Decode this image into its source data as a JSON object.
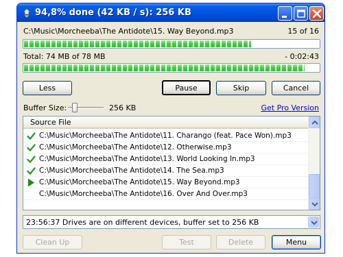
{
  "window": {
    "title": "94,8% done (42 KB / s): 256 KB"
  },
  "progress": {
    "current_file": "C:\\Music\\Morcheeba\\The Antidote\\15. Way Beyond.mp3",
    "file_count": "15 of 16",
    "file_progress_fraction": 0.77,
    "total_text": "Total: 74 MB of 78 MB",
    "remaining": "- 0:02:43",
    "total_progress_fraction": 0.95
  },
  "buttons": {
    "less": "Less",
    "pause": "Pause",
    "skip": "Skip",
    "cancel": "Cancel"
  },
  "buffer": {
    "label": "Buffer Size:",
    "value": "256 KB",
    "slider_level": 0.2,
    "pro_link": "Get Pro Version"
  },
  "list": {
    "header": "Source File",
    "rows": [
      {
        "status": "done",
        "text": "C:\\Music\\Morcheeba\\The Antidote\\11. Charango (feat. Pace Won).mp3"
      },
      {
        "status": "done",
        "text": "C:\\Music\\Morcheeba\\The Antidote\\12. Otherwise.mp3"
      },
      {
        "status": "done",
        "text": "C:\\Music\\Morcheeba\\The Antidote\\13. World Looking In.mp3"
      },
      {
        "status": "done",
        "text": "C:\\Music\\Morcheeba\\The Antidote\\14. The Sea.mp3"
      },
      {
        "status": "playing",
        "text": "C:\\Music\\Morcheeba\\The Antidote\\15. Way Beyond.mp3"
      },
      {
        "status": "pending",
        "text": "C:\\Music\\Morcheeba\\The Antidote\\16. Over And Over.mp3"
      }
    ]
  },
  "status_bar": {
    "message": "23:56:37 Drives are on different devices, buffer set to 256 KB"
  },
  "bottom_buttons": {
    "clean_up": "Clean Up",
    "test": "Test",
    "delete": "Delete",
    "menu": "Menu"
  },
  "colors": {
    "titlebar": "#0054e3",
    "progress_fill": "#3ed03e",
    "check": "#2a9d2a",
    "play": "#1f8a1f",
    "link": "#0000ee"
  },
  "icons": {
    "app": "app-icon",
    "minimize": "minimize-icon",
    "maximize": "maximize-icon",
    "close": "close-icon",
    "done": "checkmark-icon",
    "playing": "play-icon"
  }
}
